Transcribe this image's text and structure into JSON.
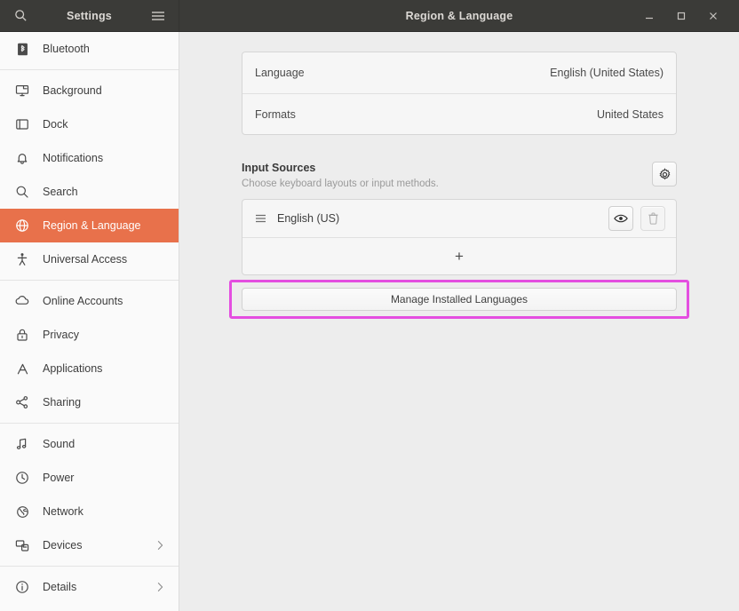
{
  "titlebar": {
    "search_icon": "search-icon",
    "app_title": "Settings",
    "menu_icon": "hamburger-menu-icon",
    "panel_title": "Region & Language",
    "minimize_label": "–",
    "maximize_label": "□",
    "close_label": "✕"
  },
  "sidebar": {
    "items": [
      {
        "label": "Bluetooth",
        "icon": "bluetooth-icon",
        "selected": false,
        "chevron": false,
        "sep_after": true
      },
      {
        "label": "Background",
        "icon": "background-icon",
        "selected": false,
        "chevron": false,
        "sep_after": false
      },
      {
        "label": "Dock",
        "icon": "dock-icon",
        "selected": false,
        "chevron": false,
        "sep_after": false
      },
      {
        "label": "Notifications",
        "icon": "bell-icon",
        "selected": false,
        "chevron": false,
        "sep_after": false
      },
      {
        "label": "Search",
        "icon": "search-icon",
        "selected": false,
        "chevron": false,
        "sep_after": false
      },
      {
        "label": "Region & Language",
        "icon": "globe-icon",
        "selected": true,
        "chevron": false,
        "sep_after": false
      },
      {
        "label": "Universal Access",
        "icon": "accessibility-icon",
        "selected": false,
        "chevron": false,
        "sep_after": true
      },
      {
        "label": "Online Accounts",
        "icon": "cloud-icon",
        "selected": false,
        "chevron": false,
        "sep_after": false
      },
      {
        "label": "Privacy",
        "icon": "lock-icon",
        "selected": false,
        "chevron": false,
        "sep_after": false
      },
      {
        "label": "Applications",
        "icon": "applications-icon",
        "selected": false,
        "chevron": false,
        "sep_after": false
      },
      {
        "label": "Sharing",
        "icon": "share-icon",
        "selected": false,
        "chevron": false,
        "sep_after": true
      },
      {
        "label": "Sound",
        "icon": "sound-note-icon",
        "selected": false,
        "chevron": false,
        "sep_after": false
      },
      {
        "label": "Power",
        "icon": "power-icon",
        "selected": false,
        "chevron": false,
        "sep_after": false
      },
      {
        "label": "Network",
        "icon": "network-globe-icon",
        "selected": false,
        "chevron": false,
        "sep_after": false
      },
      {
        "label": "Devices",
        "icon": "devices-icon",
        "selected": false,
        "chevron": true,
        "sep_after": true
      },
      {
        "label": "Details",
        "icon": "info-icon",
        "selected": false,
        "chevron": true,
        "sep_after": false
      }
    ]
  },
  "main": {
    "language_row": {
      "label": "Language",
      "value": "English (United States)"
    },
    "formats_row": {
      "label": "Formats",
      "value": "United States"
    },
    "input_sources": {
      "title": "Input Sources",
      "subtitle": "Choose keyboard layouts or input methods.",
      "settings_icon": "gear-icon",
      "items": [
        {
          "name": "English (US)",
          "handle_icon": "drag-handle-icon",
          "preview_icon": "eye-icon",
          "remove_icon": "trash-icon"
        }
      ],
      "add_label": "+"
    },
    "manage_button": "Manage Installed Languages"
  },
  "annotation": {
    "highlight_color": "#e44ee0",
    "target": "manage-installed-languages-button"
  },
  "colors": {
    "accent_orange": "#e8714b",
    "titlebar": "#3b3b38",
    "content_bg": "#ededed",
    "sidebar_bg": "#fafafa"
  }
}
